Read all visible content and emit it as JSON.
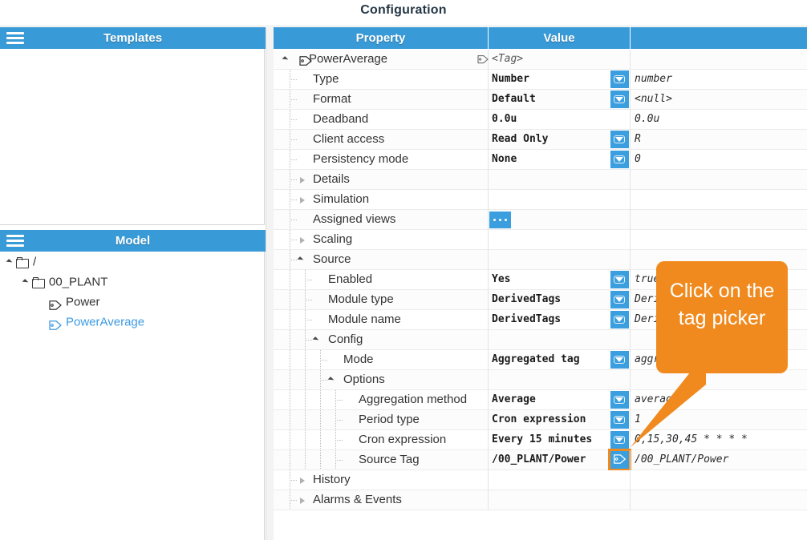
{
  "window": {
    "title": "Configuration"
  },
  "colors": {
    "accent": "#389ad6",
    "button": "#3b9ede",
    "callout": "#f08a1e",
    "selected_text": "#3d9ae2",
    "row_alt": "#fcfcfc"
  },
  "panels": {
    "templates": {
      "title": "Templates",
      "menu_icon": "hamburger-icon",
      "items": []
    },
    "model": {
      "title": "Model",
      "menu_icon": "hamburger-icon",
      "tree": [
        {
          "label": "/",
          "icon": "folder-icon",
          "indent": 0,
          "expander": "open",
          "selected": false
        },
        {
          "label": "00_PLANT",
          "icon": "folder-icon",
          "indent": 1,
          "expander": "open",
          "selected": false
        },
        {
          "label": "Power",
          "icon": "tag-icon",
          "indent": 2,
          "expander": "none",
          "selected": false
        },
        {
          "label": "PowerAverage",
          "icon": "tag-icon",
          "indent": 2,
          "expander": "none",
          "selected": true
        }
      ]
    }
  },
  "grid": {
    "columns": [
      "Property",
      "Value",
      ""
    ],
    "rows": [
      {
        "property": "PowerAverage",
        "indent": 0,
        "expander": "open",
        "icon": "tag-icon",
        "value": "",
        "raw": "<Tag>",
        "control": "none",
        "root": true
      },
      {
        "property": "Type",
        "indent": 1,
        "expander": "none",
        "value": "Number",
        "raw": "number",
        "control": "dropdown"
      },
      {
        "property": "Format",
        "indent": 1,
        "expander": "none",
        "value": "Default",
        "raw": "<null>",
        "control": "dropdown"
      },
      {
        "property": "Deadband",
        "indent": 1,
        "expander": "none",
        "value": "0.0u",
        "raw": "0.0u",
        "control": "none"
      },
      {
        "property": "Client access",
        "indent": 1,
        "expander": "none",
        "value": "Read Only",
        "raw": "R",
        "control": "dropdown"
      },
      {
        "property": "Persistency mode",
        "indent": 1,
        "expander": "none",
        "value": "None",
        "raw": "0",
        "control": "dropdown"
      },
      {
        "property": "Details",
        "indent": 1,
        "expander": "closed",
        "value": "",
        "raw": "",
        "control": "none"
      },
      {
        "property": "Simulation",
        "indent": 1,
        "expander": "closed",
        "value": "",
        "raw": "",
        "control": "none"
      },
      {
        "property": "Assigned views",
        "indent": 1,
        "expander": "none",
        "value": "",
        "raw": "",
        "control": "ellipsis"
      },
      {
        "property": "Scaling",
        "indent": 1,
        "expander": "closed",
        "value": "",
        "raw": "",
        "control": "none"
      },
      {
        "property": "Source",
        "indent": 1,
        "expander": "open",
        "value": "",
        "raw": "",
        "control": "none"
      },
      {
        "property": "Enabled",
        "indent": 2,
        "expander": "none",
        "value": "Yes",
        "raw": "true",
        "control": "dropdown"
      },
      {
        "property": "Module type",
        "indent": 2,
        "expander": "none",
        "value": "DerivedTags",
        "raw": "DerivedTags",
        "control": "dropdown"
      },
      {
        "property": "Module name",
        "indent": 2,
        "expander": "none",
        "value": "DerivedTags",
        "raw": "DerivedTags",
        "control": "dropdown"
      },
      {
        "property": "Config",
        "indent": 2,
        "expander": "open",
        "value": "",
        "raw": "",
        "control": "none"
      },
      {
        "property": "Mode",
        "indent": 3,
        "expander": "none",
        "value": "Aggregated tag",
        "raw": "aggregated",
        "control": "dropdown"
      },
      {
        "property": "Options",
        "indent": 3,
        "expander": "open",
        "value": "",
        "raw": "",
        "control": "none"
      },
      {
        "property": "Aggregation method",
        "indent": 4,
        "expander": "none",
        "value": "Average",
        "raw": "average",
        "control": "dropdown"
      },
      {
        "property": "Period type",
        "indent": 4,
        "expander": "none",
        "value": "Cron expression",
        "raw": "1",
        "control": "dropdown"
      },
      {
        "property": "Cron expression",
        "indent": 4,
        "expander": "none",
        "value": "Every 15 minutes",
        "raw": "0,15,30,45 * * * *",
        "control": "dropdown"
      },
      {
        "property": "Source Tag",
        "indent": 4,
        "expander": "none",
        "value": "/00_PLANT/Power",
        "raw": "/00_PLANT/Power",
        "control": "tagpicker",
        "highlighted": true
      },
      {
        "property": "History",
        "indent": 1,
        "expander": "closed",
        "value": "",
        "raw": "",
        "control": "none"
      },
      {
        "property": "Alarms & Events",
        "indent": 1,
        "expander": "closed",
        "value": "",
        "raw": "",
        "control": "none"
      }
    ]
  },
  "callout": {
    "text": "Click on the tag picker",
    "target": "tag-picker-button"
  }
}
